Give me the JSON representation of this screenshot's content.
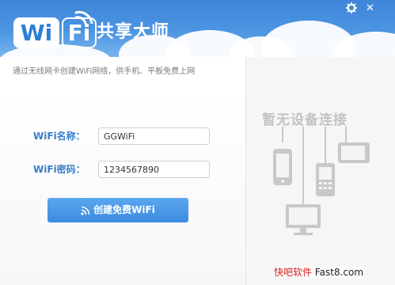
{
  "header": {
    "logo_wi": "Wi",
    "logo_fi": "Fi",
    "app_title": "共享大师",
    "settings_icon": "gear-icon",
    "close_icon": "close-icon",
    "close_glyph": "✕"
  },
  "subtitle": "通过无线网卡创建WiFi网络，供手机、平板免费上网",
  "form": {
    "name_label": "WiFi名称：",
    "name_value": "GGWiFi",
    "password_label": "WiFi密码：",
    "password_value": "1234567890",
    "create_button": "创建免费WiFi"
  },
  "devices_panel": {
    "empty_text": "暂无设备连接"
  },
  "watermark": {
    "text_red": "快吧软件",
    "text_site": "Fast8.com"
  },
  "colors": {
    "header_blue": "#4c95e2",
    "label_blue": "#3a7dc9",
    "button_blue": "#4a97e7",
    "device_gray": "#c8c8c8"
  }
}
